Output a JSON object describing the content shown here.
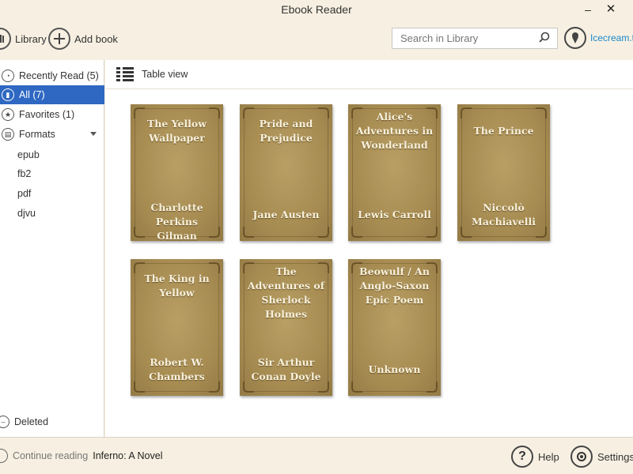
{
  "window": {
    "title": "Ebook Reader",
    "minimize_glyph": "–",
    "close_glyph": "✕"
  },
  "toolbar": {
    "library_label": "Library",
    "add_book_label": "Add book",
    "search_placeholder": "Search in Library",
    "brand_label": "Icecream.t"
  },
  "sidebar": {
    "recently_read": "Recently Read (5)",
    "all": "All (7)",
    "favorites": "Favorites (1)",
    "formats": "Formats",
    "format_items": [
      "epub",
      "fb2",
      "pdf",
      "djvu"
    ],
    "deleted": "Deleted"
  },
  "view": {
    "toggle_label": "Table view"
  },
  "books": [
    {
      "title": "The Yellow Wallpaper",
      "author": "Charlotte Perkins Gilman"
    },
    {
      "title": "Pride and Prejudice",
      "author": "Jane Austen"
    },
    {
      "title": "Alice's Adventures in Wonderland",
      "author": "Lewis Carroll"
    },
    {
      "title": "The Prince",
      "author": "Niccolò Machiavelli"
    },
    {
      "title": "The King in Yellow",
      "author": "Robert W. Chambers"
    },
    {
      "title": "The Adventures of Sherlock Holmes",
      "author": "Sir Arthur Conan Doyle"
    },
    {
      "title": "Beowulf / An Anglo-Saxon Epic Poem",
      "author": "Unknown"
    }
  ],
  "footer": {
    "continue_label": "Continue reading",
    "continue_book": "Inferno: A Novel",
    "help_label": "Help",
    "settings_label": "Settings"
  },
  "colors": {
    "accent": "#2e68c2",
    "brand": "#1b87c9",
    "cover": "#a78c52"
  },
  "icons": {
    "library": "library-icon",
    "add_book": "plus-icon",
    "search": "search-icon",
    "brand": "icecream-logo-icon",
    "table_view": "list-icon",
    "help": "question-icon",
    "settings": "gear-icon"
  }
}
